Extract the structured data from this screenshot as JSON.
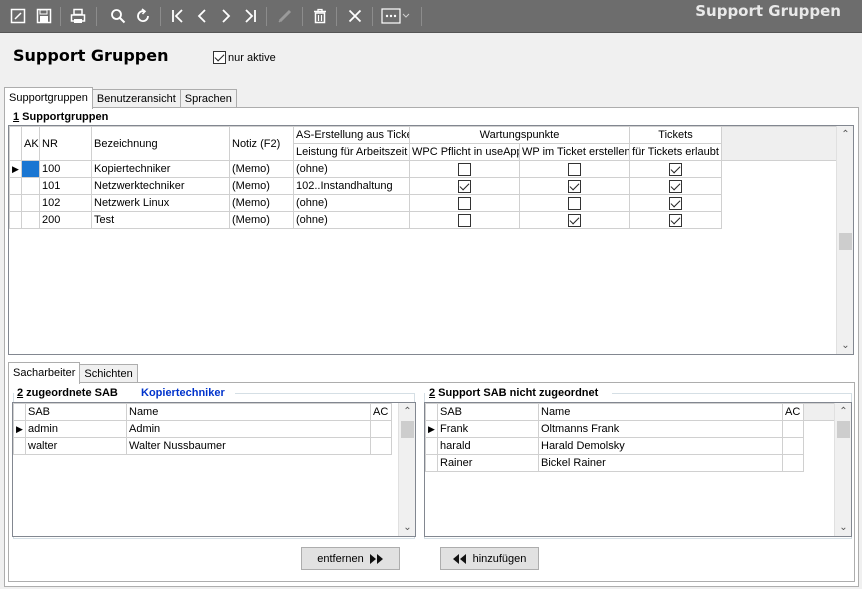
{
  "toolbar": {
    "app_title": "Support Gruppen",
    "icons": [
      "new-record-icon",
      "save-icon",
      "print-icon",
      "search-icon",
      "refresh-icon",
      "first-record-icon",
      "previous-record-icon",
      "next-record-icon",
      "last-record-icon",
      "edit-icon",
      "delete-icon",
      "close-icon",
      "more-icon"
    ]
  },
  "header": {
    "title": "Support Gruppen",
    "nur_aktive_label": "nur aktive",
    "nur_aktive_checked": true
  },
  "top_tabs": [
    "Supportgruppen",
    "Benutzeransicht",
    "Sprachen"
  ],
  "supportgruppen": {
    "section_number": "1",
    "section_label": " Supportgruppen",
    "group_headers": {
      "as_erstellung": "AS-Erstellung aus Ticket",
      "wartungspunkte": "Wartungspunkte",
      "tickets": "Tickets"
    },
    "columns": {
      "ak": "AK",
      "nr": "NR",
      "bezeichnung": "Bezeichnung",
      "notiz": "Notiz (F2)",
      "leistung": "Leistung für Arbeitszeit",
      "wpc": "WPC Pflicht in useApp",
      "wp": "WP im Ticket erstellen",
      "tickets_erlaubt": "für Tickets erlaubt"
    },
    "rows": [
      {
        "nr": "100",
        "bezeichnung": "Kopiertechniker",
        "notiz": "(Memo)",
        "leistung": "(ohne)",
        "wpc": false,
        "wp": false,
        "tickets": true
      },
      {
        "nr": "101",
        "bezeichnung": "Netzwerktechniker",
        "notiz": "(Memo)",
        "leistung": "102..Instandhaltung",
        "wpc": true,
        "wp": true,
        "tickets": true
      },
      {
        "nr": "102",
        "bezeichnung": "Netzwerk Linux",
        "notiz": "(Memo)",
        "leistung": "(ohne)",
        "wpc": false,
        "wp": false,
        "tickets": true
      },
      {
        "nr": "200",
        "bezeichnung": "Test",
        "notiz": "(Memo)",
        "leistung": "(ohne)",
        "wpc": false,
        "wp": true,
        "tickets": true
      }
    ]
  },
  "bottom_tabs": [
    "Sacharbeiter",
    "Schichten"
  ],
  "zugeordnet": {
    "section_number": "2",
    "section_label": " zugeordnete SAB",
    "group_name": "Kopiertechniker",
    "columns": {
      "sab": "SAB",
      "name": "Name",
      "ac": "AC"
    },
    "rows": [
      {
        "sab": "admin",
        "name": "Admin"
      },
      {
        "sab": "walter",
        "name": "Walter Nussbaumer"
      }
    ]
  },
  "nicht_zugeordnet": {
    "section_number": "2",
    "section_label": " Support SAB nicht zugeordnet",
    "columns": {
      "sab": "SAB",
      "name": "Name",
      "ac": "AC"
    },
    "rows": [
      {
        "sab": "Frank",
        "name": "Oltmanns Frank"
      },
      {
        "sab": "harald",
        "name": "Harald Demolsky"
      },
      {
        "sab": "Rainer",
        "name": "Bickel Rainer"
      }
    ]
  },
  "buttons": {
    "entfernen": "entfernen",
    "hinzufuegen": "hinzufügen"
  }
}
